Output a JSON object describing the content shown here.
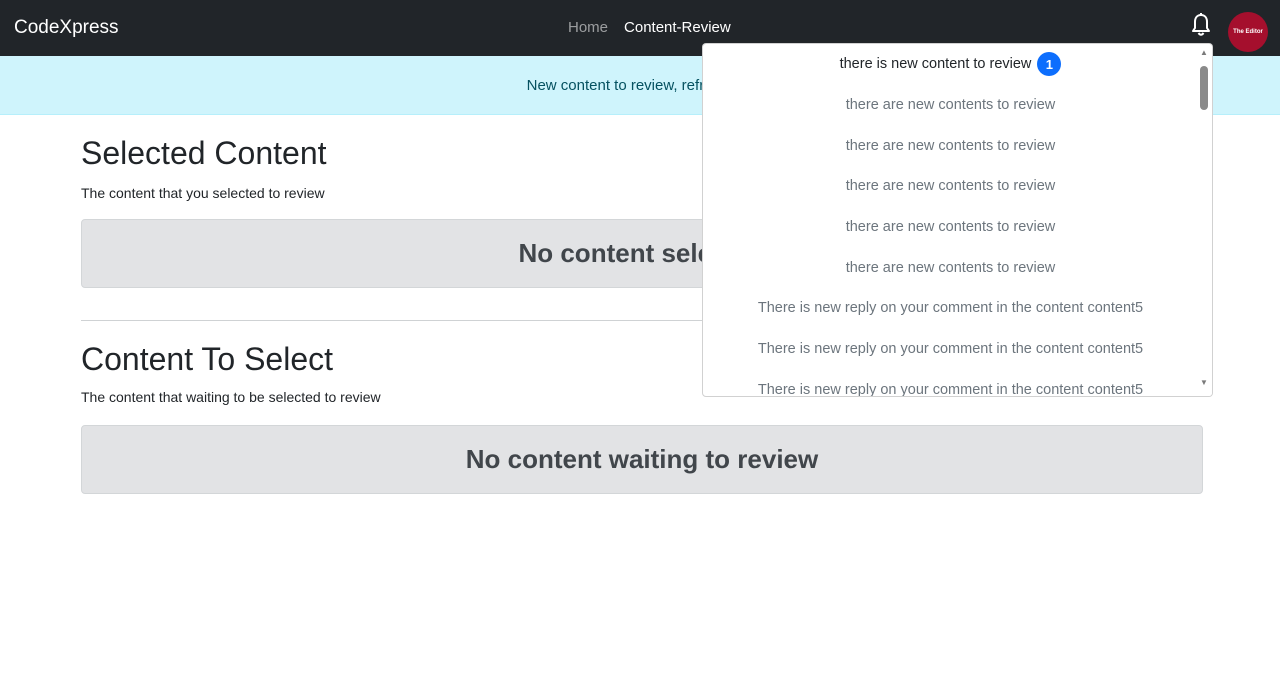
{
  "navbar": {
    "brand": "CodeXpress",
    "links": [
      {
        "label": "Home",
        "active": false
      },
      {
        "label": "Content-Review",
        "active": true
      }
    ],
    "bell_icon": "bell-icon",
    "avatar_text": "The Editor",
    "avatar_color": "#a50f2d",
    "background": "#212529"
  },
  "alert": {
    "text": "New content to review, refrech the"
  },
  "selected": {
    "title": "Selected Content",
    "subtitle": "The content that you selected to review",
    "empty_text": "No content selected"
  },
  "to_select": {
    "title": "Content To Select",
    "subtitle": "The content that waiting to be selected to review",
    "empty_text": "No content waiting to review"
  },
  "notifications": {
    "badge_count": "1",
    "badge_color": "#0d6efd",
    "items": [
      {
        "text": "there is new content to review"
      },
      {
        "text": "there are new contents to review"
      },
      {
        "text": "there are new contents to review"
      },
      {
        "text": "there are new contents to review"
      },
      {
        "text": "there are new contents to review"
      },
      {
        "text": "there are new contents to review"
      },
      {
        "text": "There is new reply on your comment in the content content5"
      },
      {
        "text": "There is new reply on your comment in the content content5"
      },
      {
        "text": "There is new reply on your comment in the content content5"
      }
    ]
  }
}
